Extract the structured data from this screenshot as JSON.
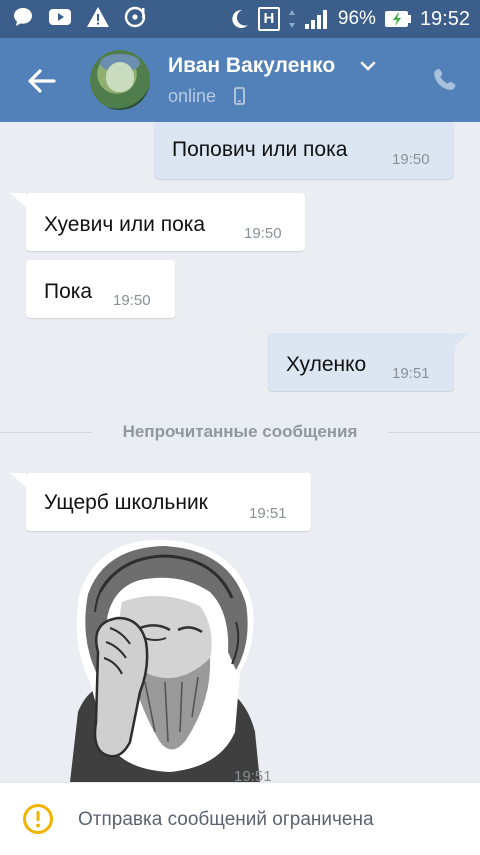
{
  "status_bar": {
    "battery": "96%",
    "time": "19:52",
    "network_badge": "H",
    "icons": [
      "chat-bubble-icon",
      "youtube-icon",
      "warning-icon",
      "vinyl-icon",
      "moon-icon",
      "network-h-icon",
      "signal-icon",
      "battery-charging-icon"
    ]
  },
  "header": {
    "contact_name": "Иван Вакуленко",
    "presence": "online",
    "icons": [
      "back-arrow-icon",
      "chevron-down-icon",
      "mobile-phone-icon",
      "phone-call-icon"
    ]
  },
  "messages": [
    {
      "direction": "out",
      "text": "Попович или пока",
      "time": "19:50"
    },
    {
      "direction": "in",
      "text": "Хуевич или пока",
      "time": "19:50"
    },
    {
      "direction": "in",
      "text": "Пока",
      "time": "19:50"
    },
    {
      "direction": "out",
      "text": "Хуленко",
      "time": "19:51"
    },
    {
      "direction": "in",
      "text": "Ущерб школьник",
      "time": "19:51"
    },
    {
      "direction": "in",
      "type": "sticker",
      "sticker": "facepalm-sticker",
      "time": "19:51"
    }
  ],
  "unread_divider": "Непрочитанные сообщения",
  "notice": {
    "text": "Отправка сообщений ограничена",
    "icon": "warning-circle-icon",
    "color": "#f0b400"
  },
  "colors": {
    "status_bar": "#3b5f8a",
    "header": "#5181b8",
    "chat_bg": "#eaeef2",
    "bubble_out": "#dce6f3",
    "bubble_in": "#ffffff"
  }
}
